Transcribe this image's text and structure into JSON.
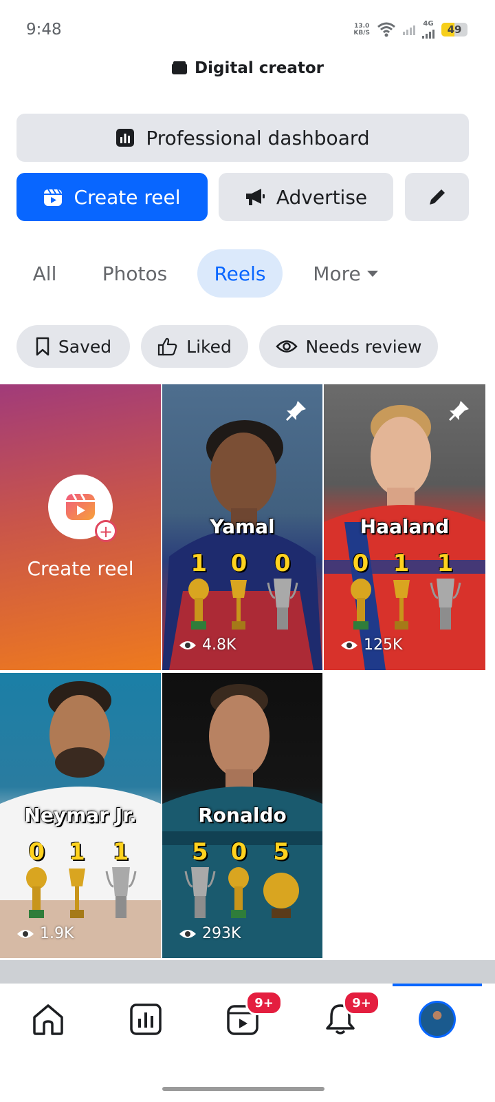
{
  "status_bar": {
    "time": "9:48",
    "net_speed_value": "13.0",
    "net_speed_unit": "KB/S",
    "network": "4G",
    "battery": "49",
    "battery_level": 0.49
  },
  "header": {
    "title": "Digital creator"
  },
  "actions": {
    "dashboard_label": "Professional dashboard",
    "create_reel_label": "Create reel",
    "advertise_label": "Advertise"
  },
  "tabs": [
    {
      "label": "All",
      "active": false
    },
    {
      "label": "Photos",
      "active": false
    },
    {
      "label": "Reels",
      "active": true
    },
    {
      "label": "More",
      "active": false
    }
  ],
  "filters": [
    {
      "label": "Saved",
      "icon": "bookmark-icon"
    },
    {
      "label": "Liked",
      "icon": "thumbs-up-icon"
    },
    {
      "label": "Needs review",
      "icon": "eye-icon"
    }
  ],
  "grid": {
    "create_tile_label": "Create reel",
    "reels": [
      {
        "name": "Yamal",
        "counts": [
          "1",
          "0",
          "0"
        ],
        "views": "4.8K",
        "pinned": true
      },
      {
        "name": "Haaland",
        "counts": [
          "0",
          "1",
          "1"
        ],
        "views": "125K",
        "pinned": true
      },
      {
        "name": "Neymar Jr.",
        "counts": [
          "0",
          "1",
          "1"
        ],
        "views": "1.9K",
        "pinned": false
      },
      {
        "name": "Ronaldo",
        "counts": [
          "5",
          "0",
          "5"
        ],
        "views": "293K",
        "pinned": false
      }
    ]
  },
  "bottom_nav": {
    "items": [
      {
        "name": "home",
        "icon": "home-icon"
      },
      {
        "name": "dashboard",
        "icon": "bar-chart-icon"
      },
      {
        "name": "reels",
        "icon": "reels-icon",
        "badge": "9+"
      },
      {
        "name": "notifications",
        "icon": "bell-icon",
        "badge": "9+"
      },
      {
        "name": "profile",
        "icon": "avatar",
        "active": true
      }
    ]
  },
  "colors": {
    "accent": "#0866ff",
    "badge": "#e41e3f",
    "chip_bg": "#e4e6eb",
    "active_tab_bg": "#dbe9fb"
  }
}
